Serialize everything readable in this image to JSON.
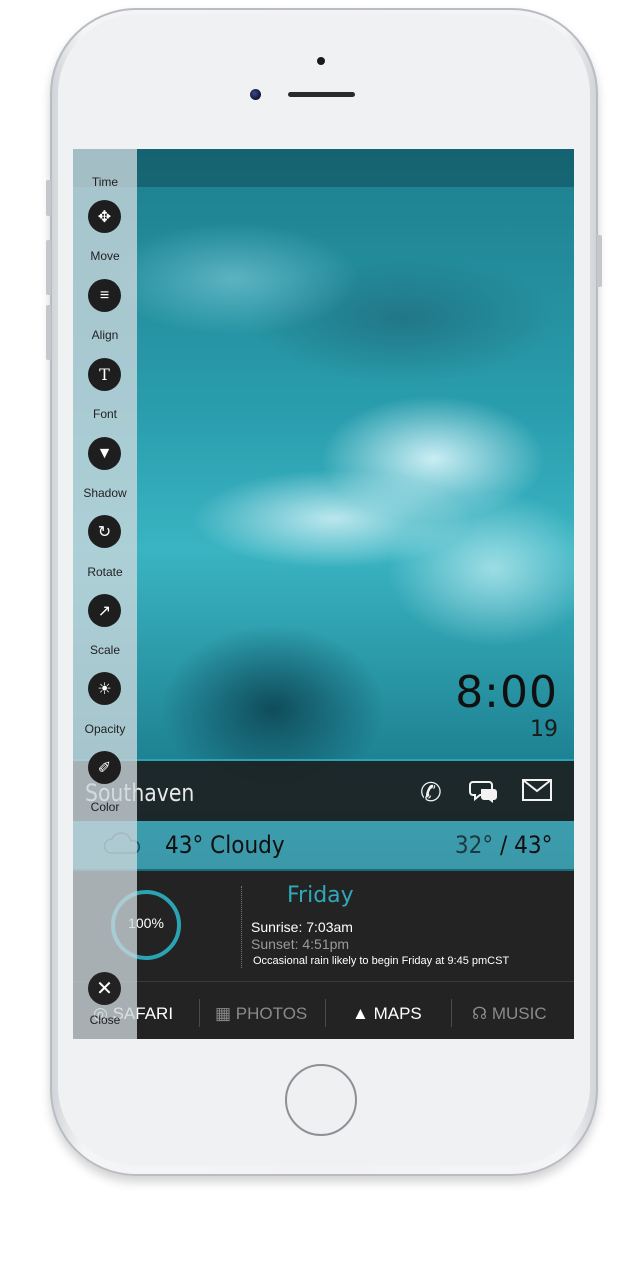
{
  "toolbar": {
    "tools": [
      {
        "label": "Time",
        "icon": "clock-icon"
      },
      {
        "label": "Move",
        "icon": "move-arrows-icon"
      },
      {
        "label": "Align",
        "icon": "align-lines-icon"
      },
      {
        "label": "Font",
        "icon": "font-icon"
      },
      {
        "label": "Shadow",
        "icon": "filter-funnel-icon"
      },
      {
        "label": "Rotate",
        "icon": "rotate-icon"
      },
      {
        "label": "Scale",
        "icon": "scale-icon"
      },
      {
        "label": "Opacity",
        "icon": "opacity-sun-icon"
      },
      {
        "label": "Color",
        "icon": "eyedropper-icon"
      }
    ],
    "close_label": "Close"
  },
  "clock": {
    "time": "8:00",
    "seconds": "19"
  },
  "contact_bar": {
    "city": "Southaven",
    "icons": [
      "phone-icon",
      "chat-icon",
      "mail-icon"
    ]
  },
  "weather": {
    "current": "43° Cloudy",
    "low": "32°",
    "separator": "/",
    "high": "43°"
  },
  "info": {
    "battery": "100%",
    "day": "Friday",
    "sunrise": "Sunrise: 7:03am",
    "sunset": "Sunset: 4:51pm",
    "forecast": "Occasional rain likely to begin Friday at 9:45 pmCST"
  },
  "dock": [
    {
      "label": "SAFARI",
      "icon": "compass-icon",
      "active": true
    },
    {
      "label": "PHOTOS",
      "icon": "photos-icon",
      "active": false
    },
    {
      "label": "MAPS",
      "icon": "navigation-arrow-icon",
      "active": true
    },
    {
      "label": "MUSIC",
      "icon": "headphones-icon",
      "active": false
    }
  ],
  "colors": {
    "accent": "#2aa4b4",
    "panel": "#232323"
  }
}
